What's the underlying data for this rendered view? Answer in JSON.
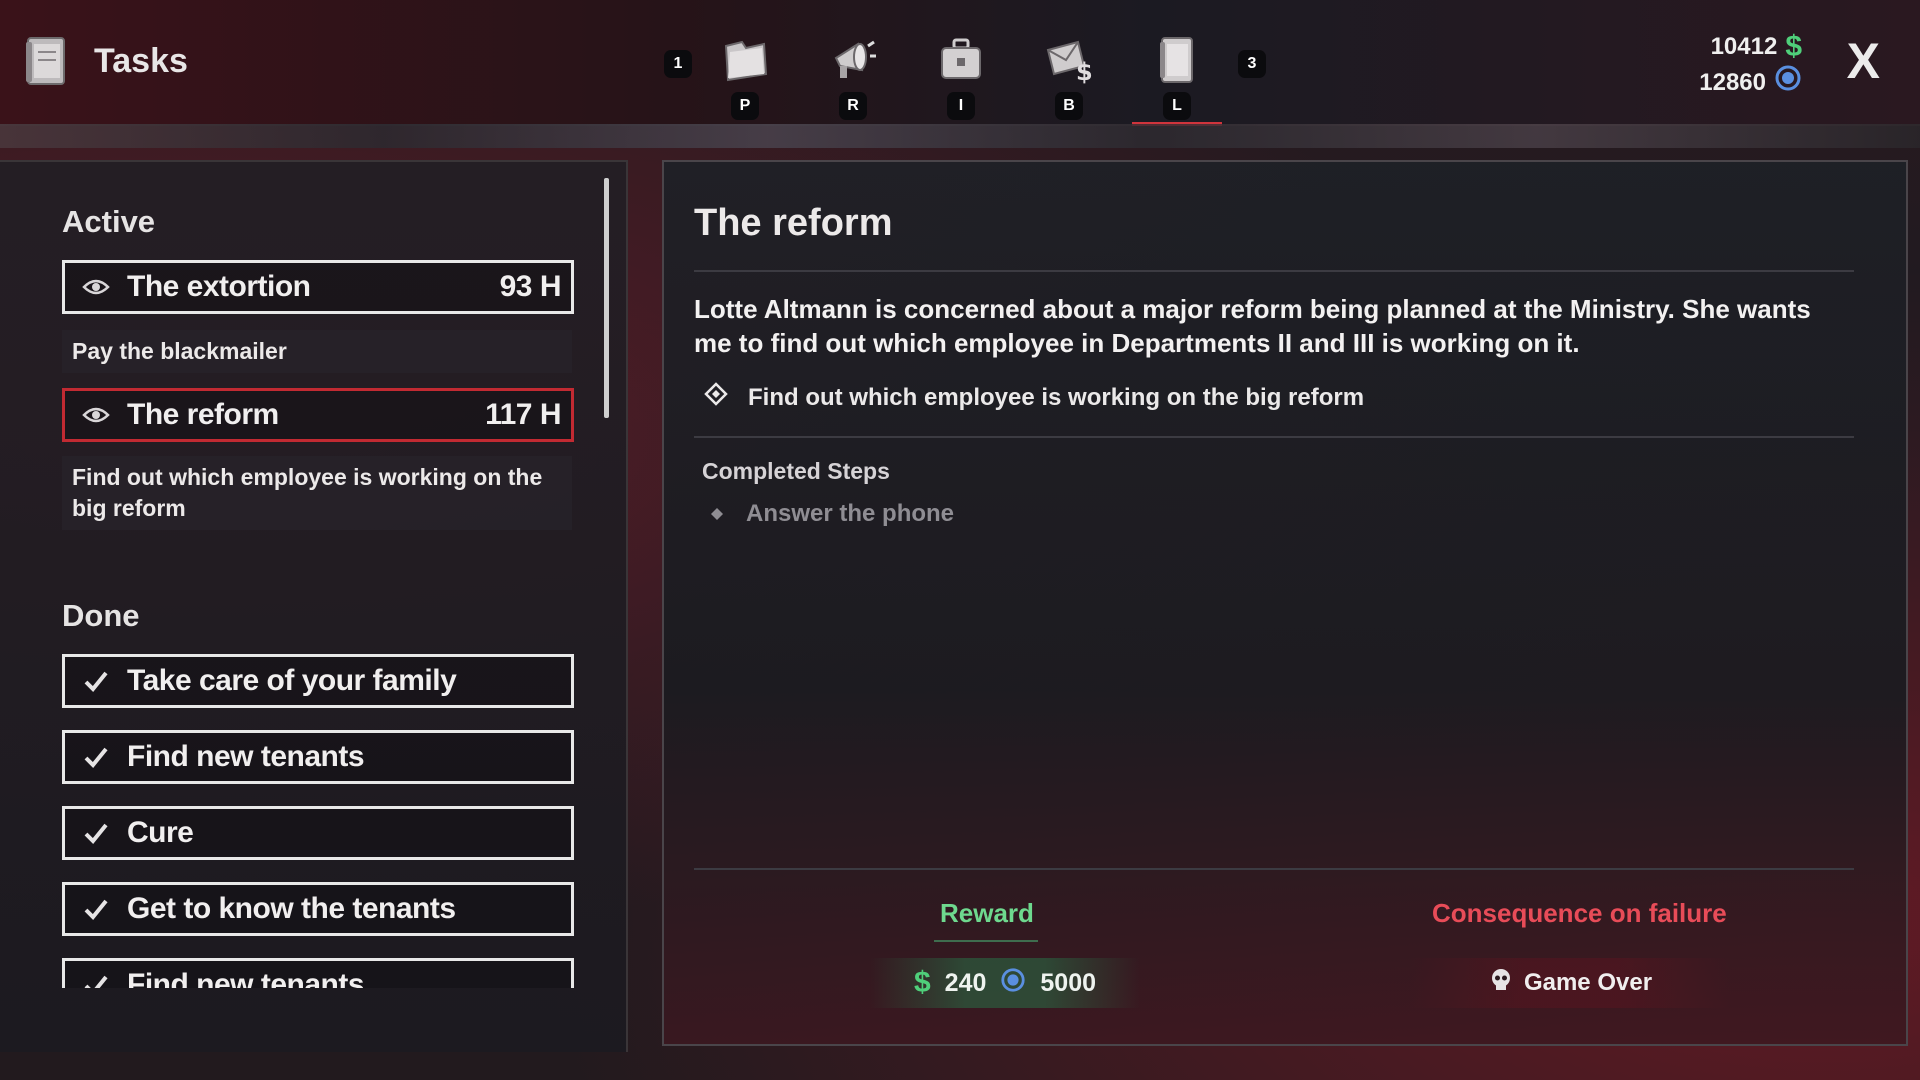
{
  "header": {
    "title": "Tasks",
    "tabs": [
      {
        "icon": "folder-icon",
        "key": "P"
      },
      {
        "icon": "megaphone-icon",
        "key": "R"
      },
      {
        "icon": "briefcase-icon",
        "key": "I"
      },
      {
        "icon": "money-envelope-icon",
        "key": "B"
      },
      {
        "icon": "logbook-icon",
        "key": "L",
        "active": true
      }
    ],
    "prev_key": "1",
    "next_key": "3",
    "money": "10412",
    "reputation": "12860",
    "close_label": "X"
  },
  "tasks": {
    "active_heading": "Active",
    "active": [
      {
        "name": "The extortion",
        "hours": "93 H",
        "description": "Pay the blackmailer",
        "selected": false
      },
      {
        "name": "The reform",
        "hours": "117 H",
        "description": "Find out which employee is working on the big reform",
        "selected": true
      }
    ],
    "done_heading": "Done",
    "done": [
      {
        "name": "Take care of your family"
      },
      {
        "name": "Find new tenants"
      },
      {
        "name": "Cure"
      },
      {
        "name": "Get to know the tenants"
      },
      {
        "name": "Find new tenants"
      }
    ]
  },
  "detail": {
    "title": "The reform",
    "description": "Lotte Altmann is concerned about a major reform being planned at the Ministry. She wants me to find out which employee in Departments II and III is working on it.",
    "objective": "Find out which employee is working on the big reform",
    "completed_heading": "Completed Steps",
    "completed_steps": [
      "Answer the phone"
    ],
    "reward_heading": "Reward",
    "reward_money": "240",
    "reward_reputation": "5000",
    "failure_heading": "Consequence on failure",
    "failure_text": "Game Over"
  },
  "colors": {
    "accent_red": "#c22a32",
    "reward_green": "#6ed98e",
    "failure_red": "#e84c58",
    "money_green": "#4fcf7a",
    "reputation_blue": "#5a8fe0"
  }
}
